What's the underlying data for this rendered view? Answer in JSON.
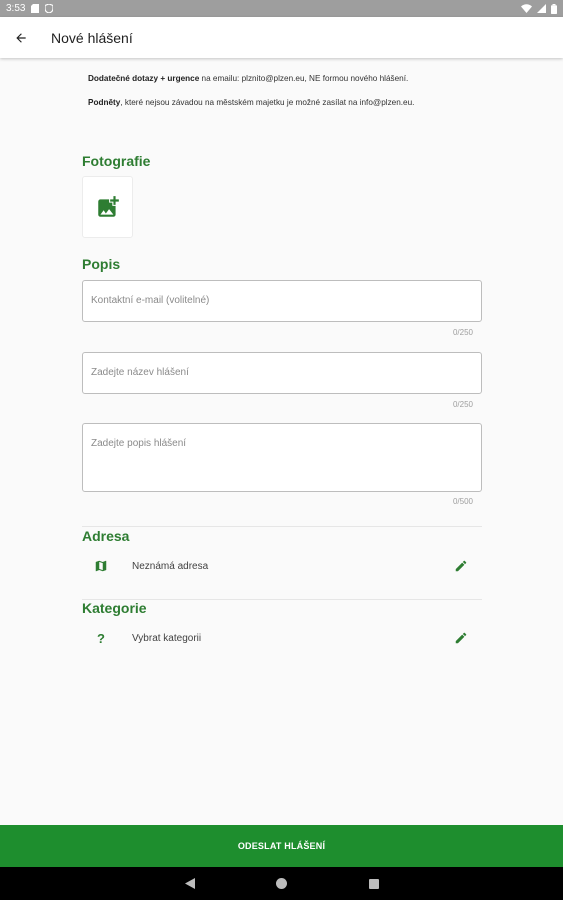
{
  "statusbar": {
    "time": "3:53"
  },
  "appbar": {
    "title": "Nové hlášení"
  },
  "info": {
    "line1_bold": "Dodatečné dotazy + urgence",
    "line1_rest": " na emailu: plznito@plzen.eu, NE formou nového hlášení.",
    "line2_bold": "Podněty",
    "line2_rest": ", které nejsou závadou na městském majetku je možné zasílat na info@plzen.eu."
  },
  "sections": {
    "photos": "Fotografie",
    "description": "Popis",
    "address": "Adresa",
    "category": "Kategorie"
  },
  "fields": {
    "email": {
      "placeholder": "Kontaktní e-mail (volitelné)",
      "counter": "0/250"
    },
    "name": {
      "placeholder": "Zadejte název hlášení",
      "counter": "0/250"
    },
    "desc": {
      "placeholder": "Zadejte popis hlášení",
      "counter": "0/500"
    }
  },
  "address": {
    "value": "Neznámá adresa"
  },
  "category": {
    "value": "Vybrat kategorii",
    "icon_glyph": "?"
  },
  "submit": {
    "label": "ODESLAT HLÁŠENÍ"
  },
  "colors": {
    "accent": "#2e7d32",
    "button": "#1e8e2e"
  }
}
